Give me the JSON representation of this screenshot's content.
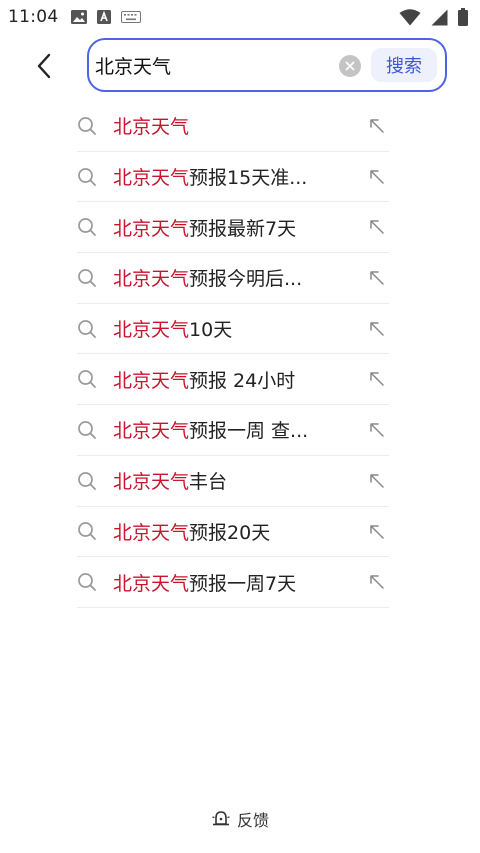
{
  "status_bar": {
    "time": "11:04",
    "left_icons": [
      "image-icon",
      "keyboard-a-icon",
      "keyboard-icon"
    ],
    "right_icons": [
      "wifi-icon",
      "signal-icon",
      "battery-icon"
    ]
  },
  "search": {
    "query": "北京天气",
    "button_label": "搜索",
    "accent_color": "#4f63e6"
  },
  "suggestions": {
    "highlight_color": "#c8142d",
    "items": [
      {
        "highlight": "北京天气",
        "rest": ""
      },
      {
        "highlight": "北京天气",
        "rest": "预报15天准..."
      },
      {
        "highlight": "北京天气",
        "rest": "预报最新7天"
      },
      {
        "highlight": "北京天气",
        "rest": "预报今明后..."
      },
      {
        "highlight": "北京天气",
        "rest": "10天"
      },
      {
        "highlight": "北京天气",
        "rest": "预报 24小时"
      },
      {
        "highlight": "北京天气",
        "rest": "预报一周 查..."
      },
      {
        "highlight": "北京天气",
        "rest": "丰台"
      },
      {
        "highlight": "北京天气",
        "rest": "预报20天"
      },
      {
        "highlight": "北京天气",
        "rest": "预报一周7天"
      }
    ]
  },
  "footer": {
    "feedback_label": "反馈"
  }
}
